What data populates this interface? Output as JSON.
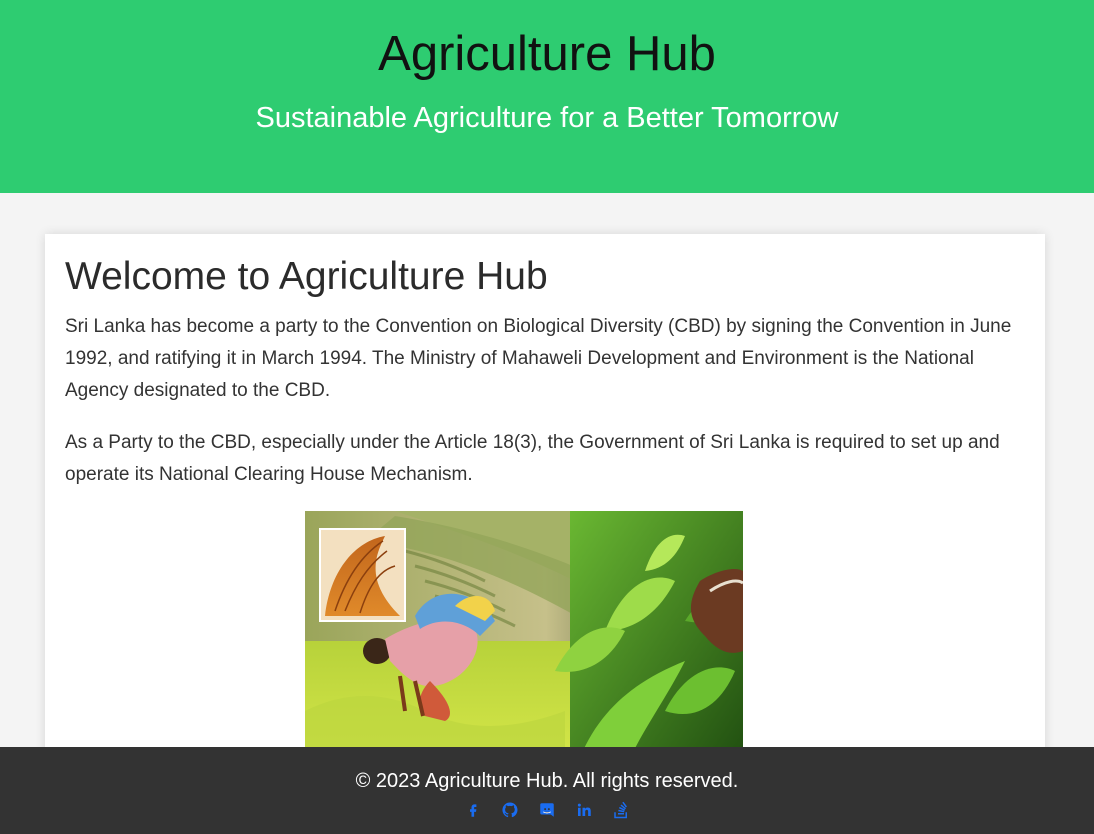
{
  "header": {
    "title": "Agriculture Hub",
    "subtitle": "Sustainable Agriculture for a Better Tomorrow"
  },
  "main": {
    "heading": "Welcome to Agriculture Hub",
    "paragraphs": [
      "Sri Lanka has become a party to the Convention on Biological Diversity (CBD) by signing the Convention in June 1992, and ratifying it in March 1994. The Ministry of Mahaweli Development and Environment is the National Agency designated to the CBD.",
      "As a Party to the CBD, especially under the Article 18(3), the Government of Sri Lanka is required to set up and operate its National Clearing House Mechanism."
    ]
  },
  "footer": {
    "copyright": "© 2023 Agriculture Hub. All rights reserved.",
    "social_icons": [
      "facebook-icon",
      "github-icon",
      "discord-icon",
      "linkedin-icon",
      "stackoverflow-icon"
    ]
  },
  "colors": {
    "header_bg": "#2ecc71",
    "footer_bg": "#333333",
    "icon": "#1a6cf0",
    "page_bg": "#f4f4f4"
  }
}
